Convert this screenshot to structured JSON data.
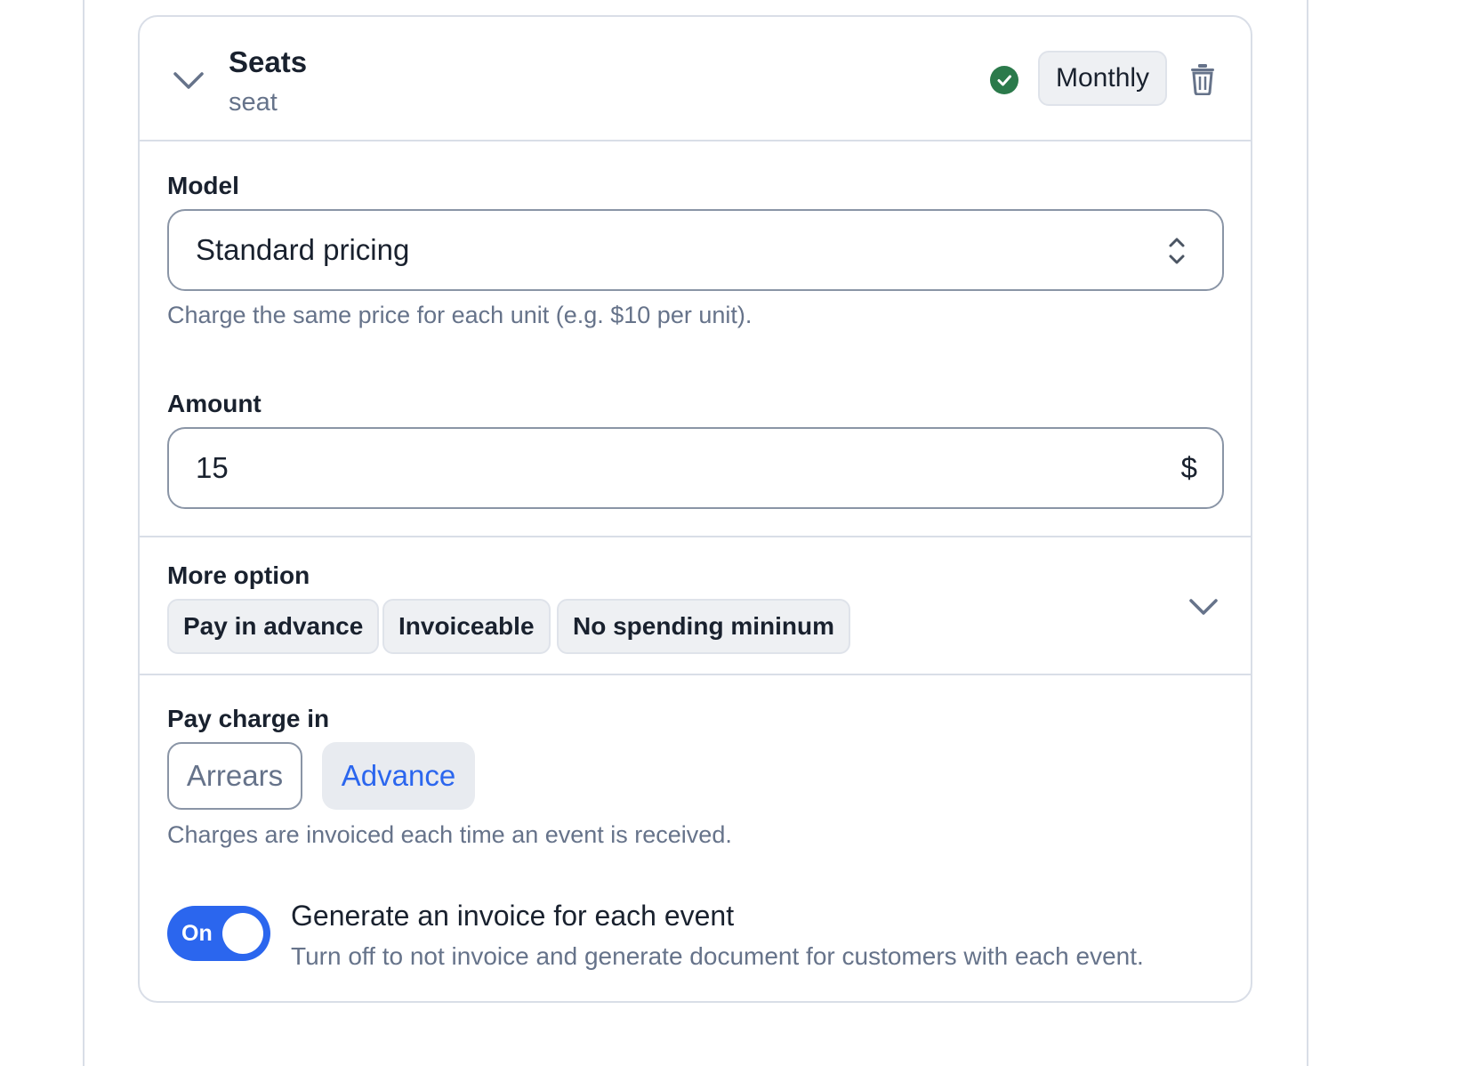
{
  "charge": {
    "title": "Seats",
    "subtitle": "seat",
    "status_icon": "check-circle-icon",
    "interval": "Monthly",
    "colors": {
      "status": "#2b7a4b",
      "accent": "#2b66ee",
      "border": "#d9dee7",
      "muted": "#66738a"
    }
  },
  "model": {
    "label": "Model",
    "value": "Standard pricing",
    "help": "Charge the same price for each unit (e.g. $10 per unit)."
  },
  "amount": {
    "label": "Amount",
    "value": "15",
    "currency": "$"
  },
  "more_options": {
    "label": "More option",
    "chips": [
      "Pay in advance",
      "Invoiceable",
      "No spending mininum"
    ]
  },
  "pay_charge": {
    "label": "Pay charge in",
    "options": [
      "Arrears",
      "Advance"
    ],
    "selected": "Advance",
    "help": "Charges are invoiced each time an event is received."
  },
  "invoice_toggle": {
    "state_label": "On",
    "enabled": true,
    "title": "Generate an invoice for each event",
    "description": "Turn off to not invoice and generate document for customers with each event."
  }
}
